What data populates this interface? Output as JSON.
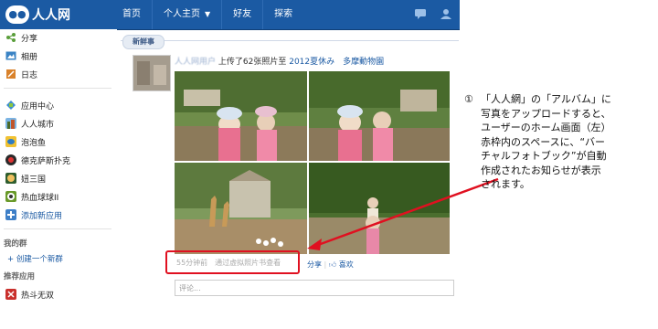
{
  "header": {
    "logo_text": "人人网",
    "nav": [
      {
        "label": "首页"
      },
      {
        "label": "个人主页",
        "has_dropdown": true
      },
      {
        "label": "好友"
      },
      {
        "label": "探索"
      }
    ],
    "icons": [
      "chat-icon",
      "friend-request-icon"
    ],
    "brand_color": "#1b5aa3"
  },
  "sidebar": {
    "items_top": [
      {
        "label": "分享",
        "icon": "share-icon"
      },
      {
        "label": "相册",
        "icon": "album-icon"
      },
      {
        "label": "日志",
        "icon": "blog-icon"
      }
    ],
    "apps": [
      {
        "label": "应用中心",
        "icon": "app-center-icon"
      },
      {
        "label": "人人城市",
        "icon": "city-icon"
      },
      {
        "label": "泡泡鱼",
        "icon": "fish-icon"
      },
      {
        "label": "德克萨斯扑克",
        "icon": "poker-icon"
      },
      {
        "label": "妞三国",
        "icon": "sanguo-icon"
      },
      {
        "label": "热血球球II",
        "icon": "ball-icon"
      },
      {
        "label": "添加新应用",
        "icon": "add-app-icon"
      }
    ],
    "groups_heading": "我的群",
    "create_group": "+ 创建一个新群",
    "recommended_heading": "推荐应用",
    "recommended": [
      {
        "label": "热斗无双",
        "icon": "game-icon"
      }
    ]
  },
  "feed": {
    "tab_label": "新鲜事",
    "post": {
      "author": "人人网用户",
      "action": "上传了62张照片至",
      "album": "2012夏休み　多摩動物園",
      "meta": "55分钟前　通过虚拟照片书查看",
      "share": "分享",
      "like": "喜欢",
      "comment_placeholder": "评论..."
    }
  },
  "annotation": {
    "number": "①",
    "lines": [
      "「人人網」の「アルバム」に",
      "写真をアップロードすると、",
      "ユーザーのホーム画面（左）",
      "赤枠内のスペースに、“バー",
      "チャルフォトブック”が自動",
      "作成されたお知らせが表示",
      "されます。"
    ],
    "highlight_color": "#e01020"
  }
}
